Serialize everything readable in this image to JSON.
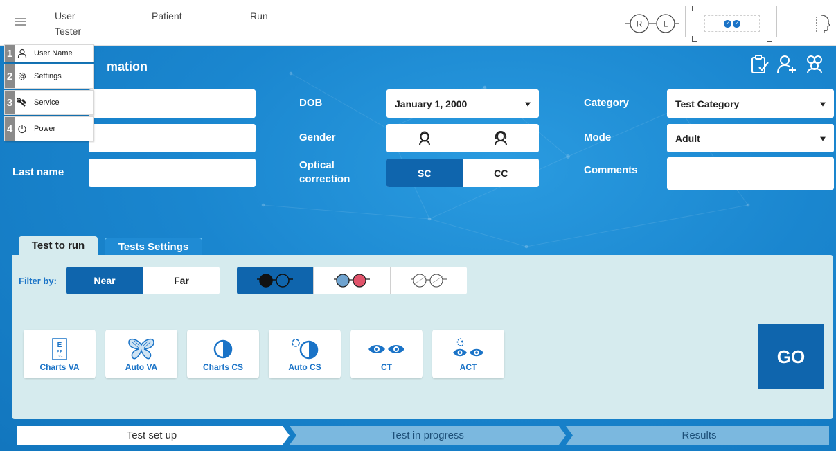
{
  "topbar": {
    "user_label": "User",
    "user_value": "Tester",
    "patient_label": "Patient",
    "run_label": "Run",
    "eye_right": "R",
    "eye_left": "L"
  },
  "menu": {
    "items": [
      {
        "num": "1",
        "label": "User Name",
        "icon": "person-icon"
      },
      {
        "num": "2",
        "label": "Settings",
        "icon": "gear-icon"
      },
      {
        "num": "3",
        "label": "Service",
        "icon": "wrench-icon"
      },
      {
        "num": "4",
        "label": "Power",
        "icon": "power-icon"
      }
    ]
  },
  "patient_info": {
    "title_partial": "mation",
    "last_name_label": "Last name",
    "dob_label": "DOB",
    "dob_value": "January 1, 2000",
    "gender_label": "Gender",
    "optical_label_line1": "Optical",
    "optical_label_line2": "correction",
    "optical_sc": "SC",
    "optical_cc": "CC",
    "category_label": "Category",
    "category_value": "Test Category",
    "mode_label": "Mode",
    "mode_value": "Adult",
    "comments_label": "Comments"
  },
  "tabs": {
    "test_to_run": "Test to run",
    "tests_settings": "Tests Settings"
  },
  "filters": {
    "label": "Filter by:",
    "near": "Near",
    "far": "Far"
  },
  "tests": [
    {
      "label": "Charts VA",
      "icon": "eye-chart-icon"
    },
    {
      "label": "Auto VA",
      "icon": "butterfly-icon"
    },
    {
      "label": "Charts CS",
      "icon": "contrast-icon"
    },
    {
      "label": "Auto CS",
      "icon": "auto-contrast-icon"
    },
    {
      "label": "CT",
      "icon": "eyes-icon"
    },
    {
      "label": "ACT",
      "icon": "alternate-eyes-icon"
    }
  ],
  "go_label": "GO",
  "progress": {
    "step1": "Test set up",
    "step2": "Test in progress",
    "step3": "Results"
  },
  "colors": {
    "primary": "#0f65ad",
    "accent": "#1a73c7",
    "background": "#1a86cf",
    "panel": "#d6ebee",
    "red_lens": "#e0536a",
    "blue_lens": "#6fa3cf"
  }
}
